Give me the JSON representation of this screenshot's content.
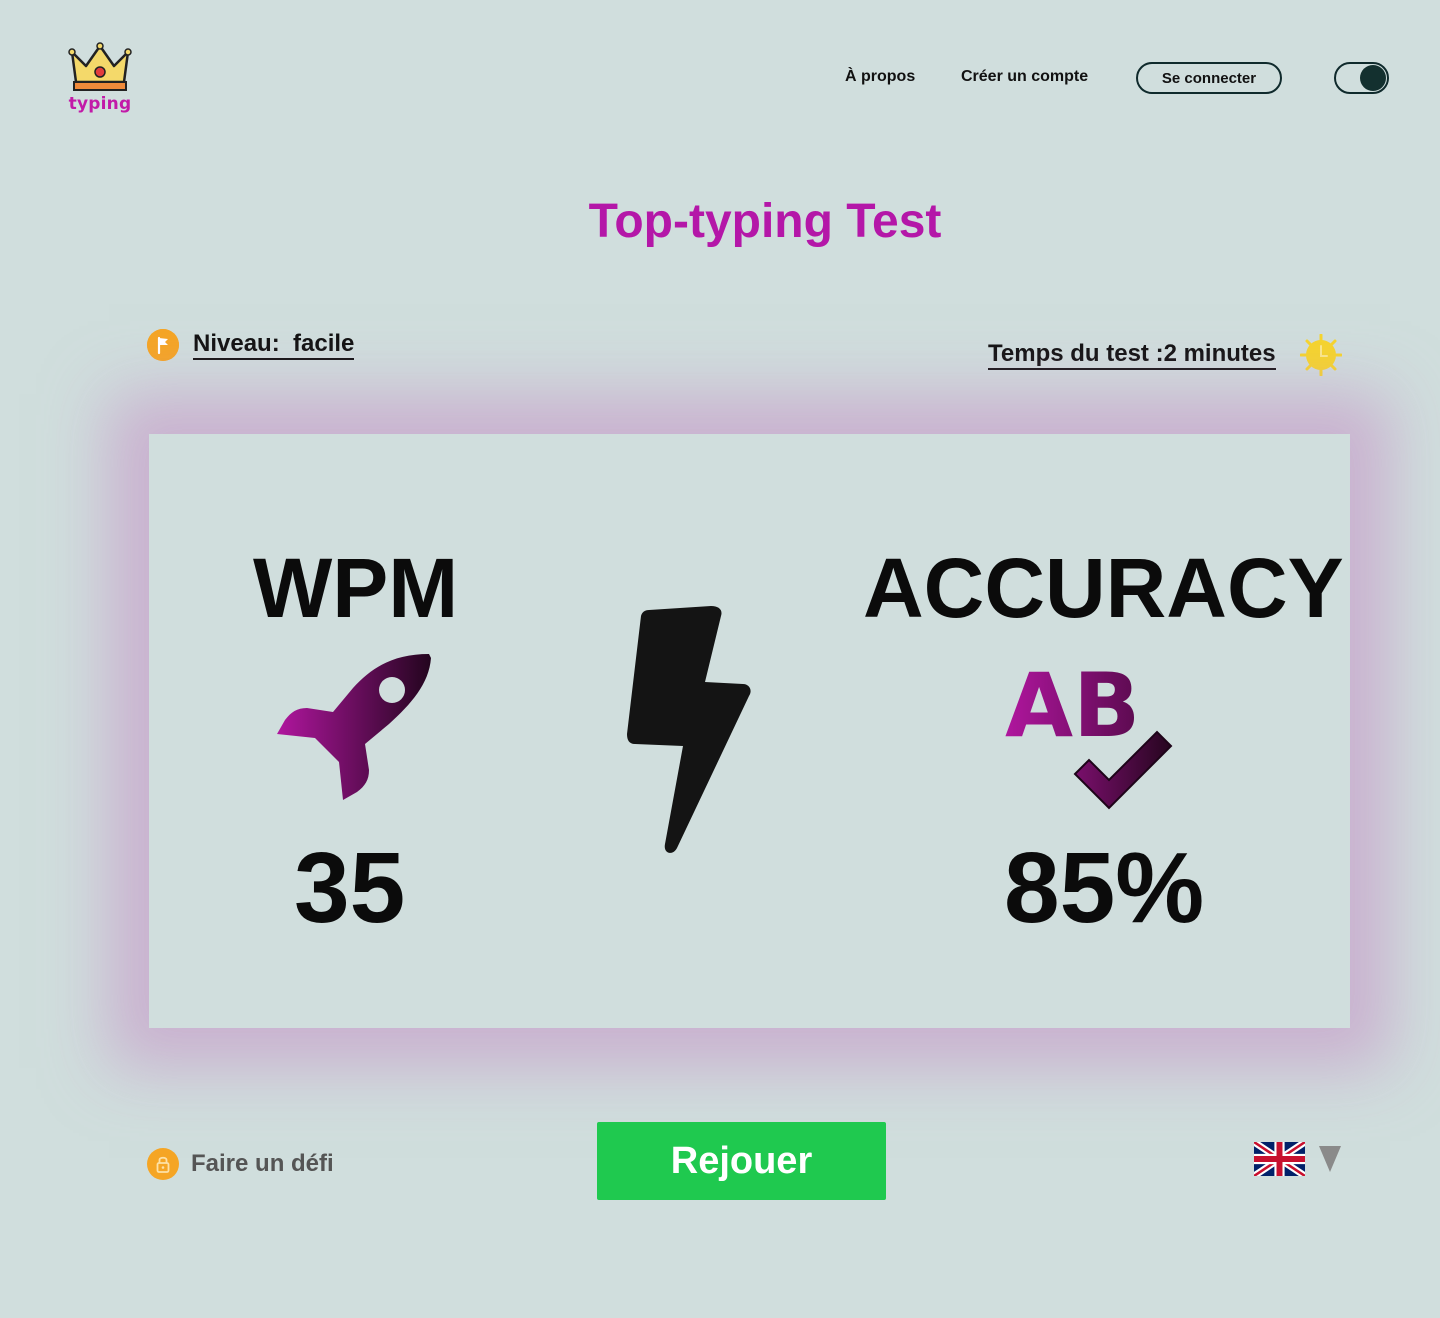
{
  "header": {
    "logo_text": "typing",
    "nav": {
      "about": "À propos",
      "signup": "Créer un compte",
      "login": "Se connecter"
    },
    "theme_toggle": {
      "state": "on"
    }
  },
  "main": {
    "title": "Top-typing Test",
    "level_label": "Niveau:  facile",
    "time_label": "Temps du test :2 minutes"
  },
  "results": {
    "wpm_label": "WPM",
    "wpm_value": "35",
    "accuracy_label": "ACCURACY",
    "accuracy_value": "85%",
    "icon_ab_text": "AB"
  },
  "footer": {
    "challenge_label": "Faire un défi",
    "replay_label": "Rejouer",
    "language_icon": "uk-flag-icon"
  },
  "colors": {
    "background": "#d0dedd",
    "title": "#b417a8",
    "replay_button": "#1fc94f",
    "badge": "#f5a524",
    "clock": "#f6d52c",
    "card_glow": "#c48cc4"
  }
}
